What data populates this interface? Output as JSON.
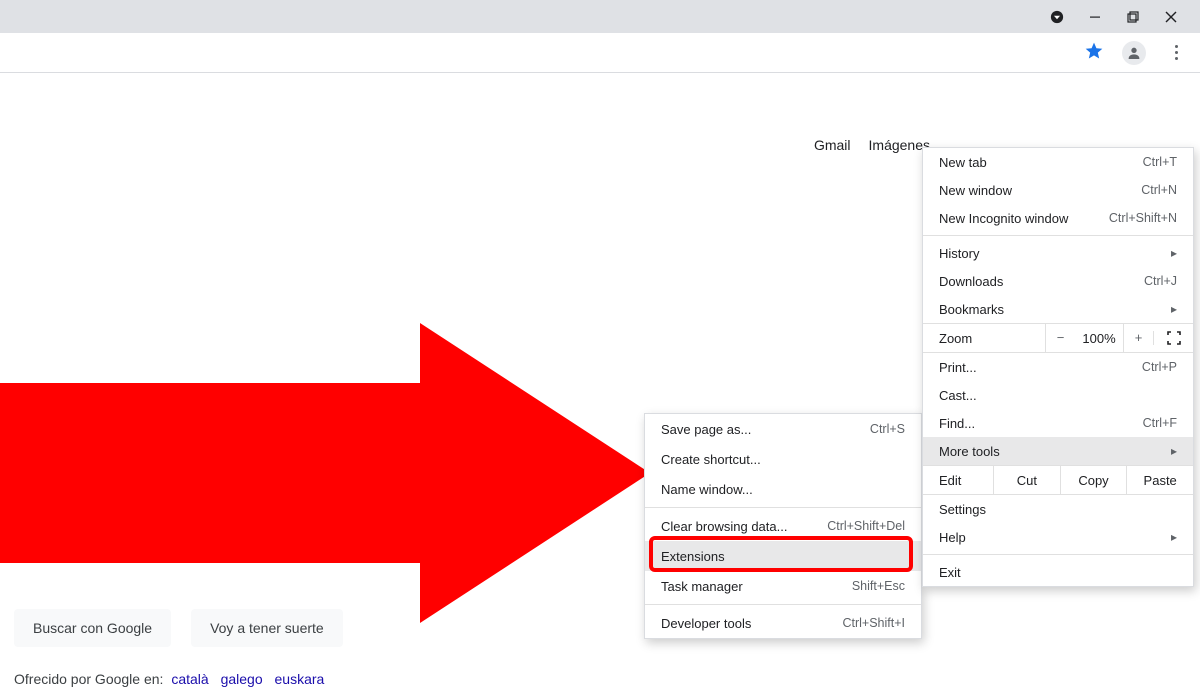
{
  "toplinks": {
    "gmail": "Gmail",
    "images": "Imágenes"
  },
  "buttons": {
    "search": "Buscar con Google",
    "lucky": "Voy a tener suerte"
  },
  "offered": {
    "prefix": "Ofrecido por Google en:",
    "langs": [
      "català",
      "galego",
      "euskara"
    ]
  },
  "menu": {
    "new_tab": "New tab",
    "new_tab_sc": "Ctrl+T",
    "new_window": "New window",
    "new_window_sc": "Ctrl+N",
    "new_incognito": "New Incognito window",
    "new_incognito_sc": "Ctrl+Shift+N",
    "history": "History",
    "downloads": "Downloads",
    "downloads_sc": "Ctrl+J",
    "bookmarks": "Bookmarks",
    "zoom": "Zoom",
    "zoom_val": "100%",
    "print": "Print...",
    "print_sc": "Ctrl+P",
    "cast": "Cast...",
    "find": "Find...",
    "find_sc": "Ctrl+F",
    "more_tools": "More tools",
    "edit": "Edit",
    "cut": "Cut",
    "copy": "Copy",
    "paste": "Paste",
    "settings": "Settings",
    "help": "Help",
    "exit": "Exit"
  },
  "submenu": {
    "save_page": "Save page as...",
    "save_page_sc": "Ctrl+S",
    "create_shortcut": "Create shortcut...",
    "name_window": "Name window...",
    "clear_browsing": "Clear browsing data...",
    "clear_browsing_sc": "Ctrl+Shift+Del",
    "extensions": "Extensions",
    "task_manager": "Task manager",
    "task_manager_sc": "Shift+Esc",
    "developer_tools": "Developer tools",
    "developer_tools_sc": "Ctrl+Shift+I"
  }
}
